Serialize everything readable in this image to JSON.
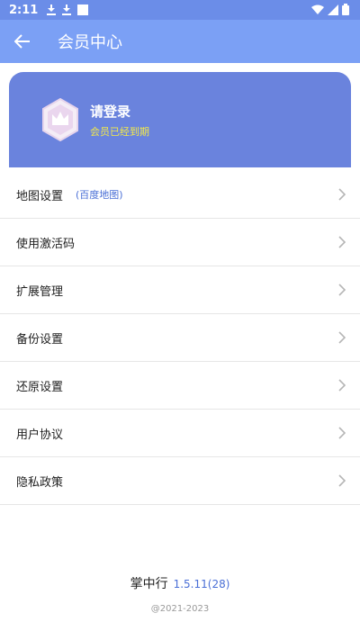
{
  "status_bar": {
    "time": "2:11"
  },
  "app_bar": {
    "title": "会员中心"
  },
  "member_card": {
    "title": "请登录",
    "subtitle": "会员已经到期",
    "card_color": "#6a83dd",
    "subtitle_color": "#f3e94a"
  },
  "menu": {
    "items": [
      {
        "label": "地图设置",
        "hint": "(百度地图)"
      },
      {
        "label": "使用激活码"
      },
      {
        "label": "扩展管理"
      },
      {
        "label": "备份设置"
      },
      {
        "label": "还原设置"
      },
      {
        "label": "用户协议"
      },
      {
        "label": "隐私政策"
      }
    ]
  },
  "footer": {
    "app_name": "掌中行",
    "version": "1.5.11(28)",
    "copyright": "@2021-2023"
  },
  "icons": {
    "back": "arrow-left-icon",
    "chevron": "chevron-right-icon",
    "badge": "crown-icon"
  }
}
